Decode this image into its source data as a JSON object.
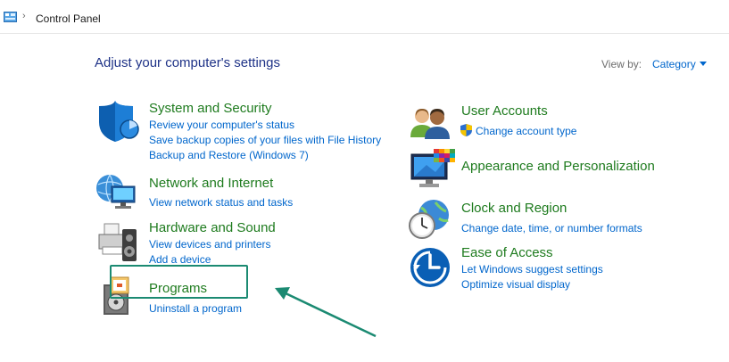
{
  "address_bar": {
    "path_icon": "control-panel-icon",
    "separator": "›",
    "location": "Control Panel"
  },
  "header": {
    "title": "Adjust your computer's settings",
    "view_by_label": "View by:",
    "view_by_value": "Category"
  },
  "categories": {
    "system_security": {
      "title": "System and Security",
      "icon": "shield-icon",
      "links": [
        "Review your computer's status",
        "Save backup copies of your files with File History",
        "Backup and Restore (Windows 7)"
      ]
    },
    "network_internet": {
      "title": "Network and Internet",
      "icon": "network-globe-icon",
      "links": [
        "View network status and tasks"
      ]
    },
    "hardware_sound": {
      "title": "Hardware and Sound",
      "icon": "printer-speaker-icon",
      "links": [
        "View devices and printers",
        "Add a device"
      ]
    },
    "programs": {
      "title": "Programs",
      "icon": "programs-disc-icon",
      "links": [
        "Uninstall a program"
      ]
    },
    "user_accounts": {
      "title": "User Accounts",
      "icon": "users-icon",
      "links": [
        "Change account type"
      ]
    },
    "appearance": {
      "title": "Appearance and Personalization",
      "icon": "monitor-palette-icon",
      "links": []
    },
    "clock_region": {
      "title": "Clock and Region",
      "icon": "clock-globe-icon",
      "links": [
        "Change date, time, or number formats"
      ]
    },
    "ease_access": {
      "title": "Ease of Access",
      "icon": "ease-of-access-icon",
      "links": [
        "Let Windows suggest settings",
        "Optimize visual display"
      ]
    }
  },
  "colors": {
    "heading": "#1e3287",
    "category_title": "#1e7b1e",
    "link": "#0066cc",
    "annotation": "#1b8a72"
  }
}
